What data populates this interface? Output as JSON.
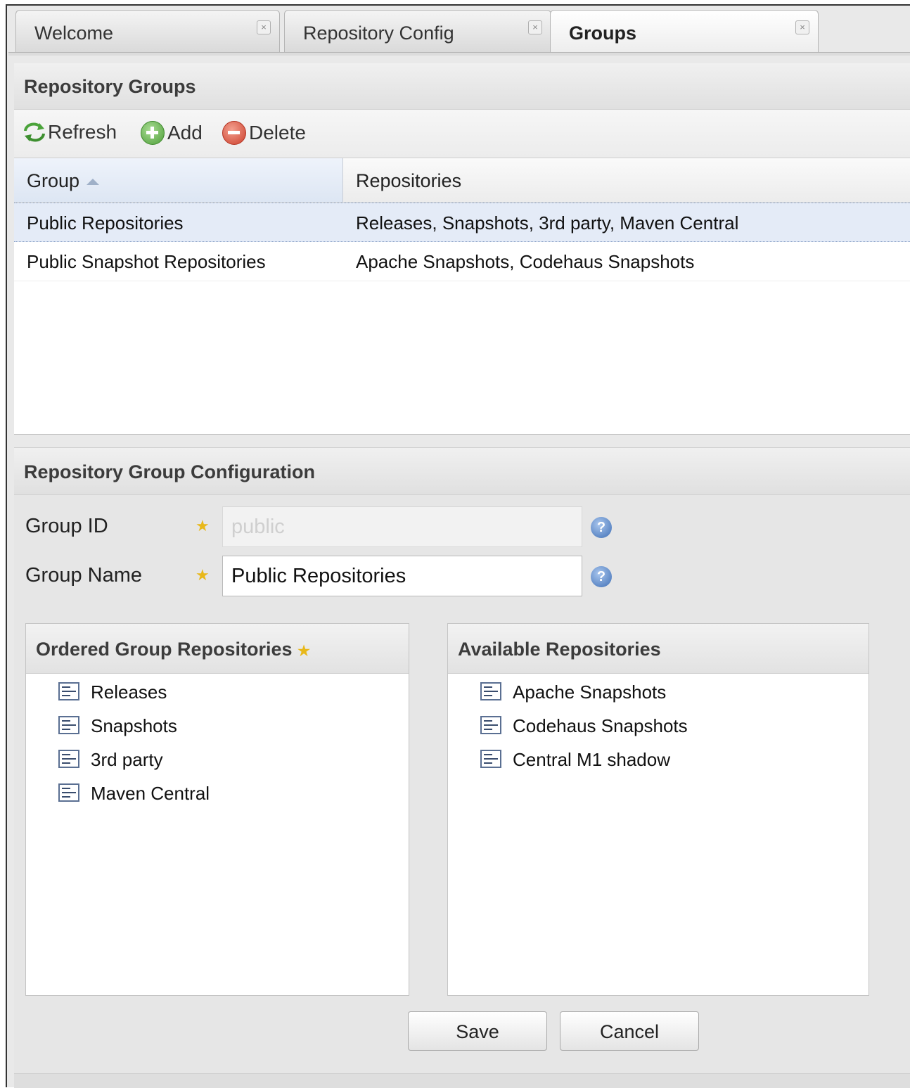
{
  "tabs": [
    {
      "label": "Welcome",
      "active": false
    },
    {
      "label": "Repository Config",
      "active": false
    },
    {
      "label": "Groups",
      "active": true
    }
  ],
  "tab_close_glyph": "×",
  "groups_panel": {
    "title": "Repository Groups",
    "toolbar": {
      "refresh": "Refresh",
      "add": "Add",
      "delete": "Delete"
    },
    "columns": {
      "group": "Group",
      "repositories": "Repositories",
      "sorted_by": "group",
      "sort_dir": "asc"
    },
    "rows": [
      {
        "group": "Public Repositories",
        "repositories": "Releases, Snapshots, 3rd party, Maven Central",
        "selected": true
      },
      {
        "group": "Public Snapshot Repositories",
        "repositories": "Apache Snapshots, Codehaus Snapshots",
        "selected": false
      }
    ]
  },
  "config_panel": {
    "title": "Repository Group Configuration",
    "group_id": {
      "label": "Group ID",
      "value": "public",
      "disabled": true
    },
    "group_name": {
      "label": "Group Name",
      "value": "Public Repositories",
      "disabled": false
    },
    "help_glyph": "?",
    "required_glyph": "★",
    "ordered": {
      "title": "Ordered Group Repositories",
      "items": [
        "Releases",
        "Snapshots",
        "3rd party",
        "Maven Central"
      ]
    },
    "available": {
      "title": "Available Repositories",
      "items": [
        "Apache Snapshots",
        "Codehaus Snapshots",
        "Central M1 shadow"
      ]
    },
    "save": "Save",
    "cancel": "Cancel"
  },
  "colors": {
    "refresh": "#4aa33a",
    "add": "#5db04a",
    "delete": "#d9533f",
    "required": "#e8b81a",
    "help": "#3f6fb5"
  }
}
